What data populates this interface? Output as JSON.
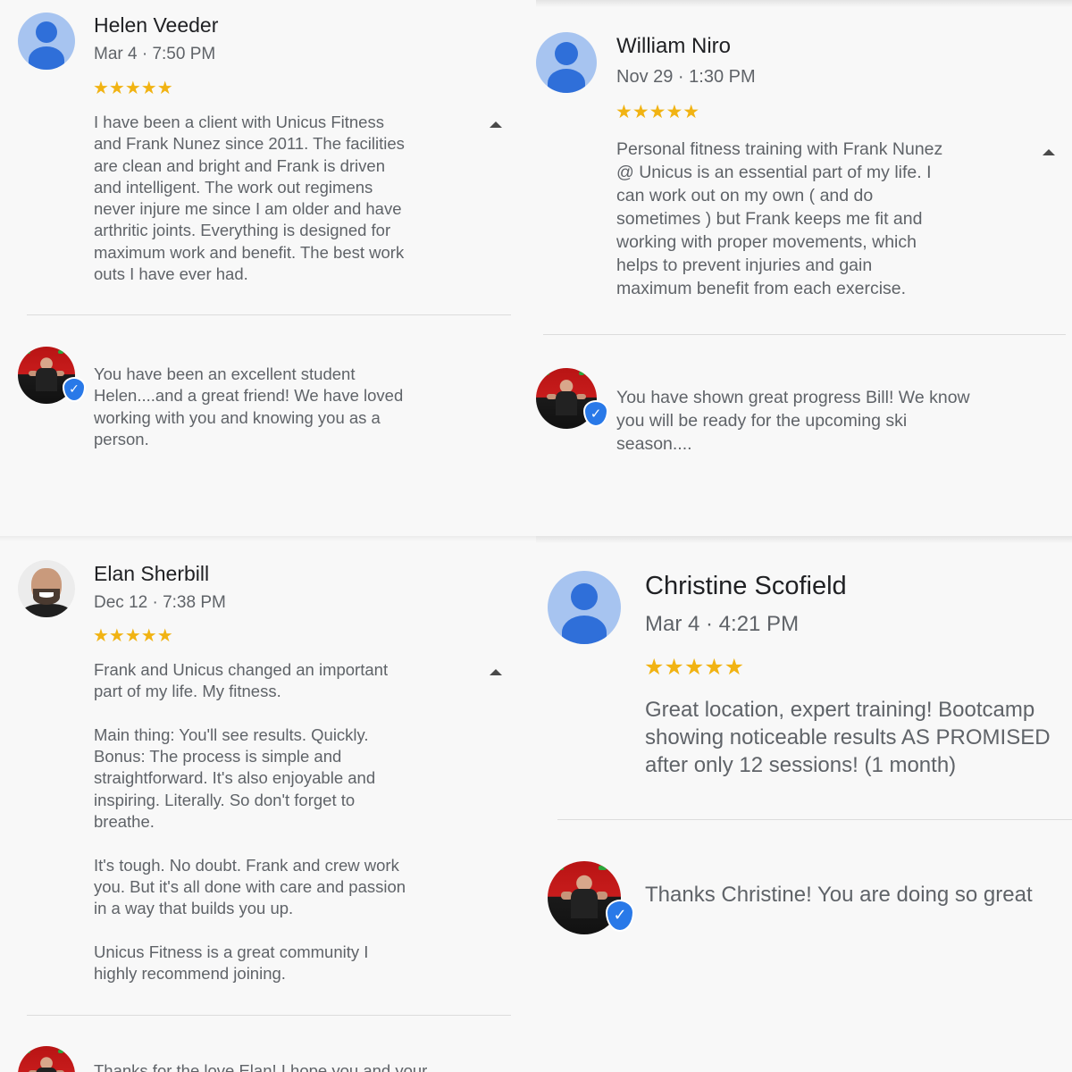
{
  "reviews": [
    {
      "name": "Helen Veeder",
      "date": "Mar 4 · 7:50 PM",
      "stars": "★★★★★",
      "text": "I have been a client with Unicus Fitness\nand Frank Nunez since 2011.  The facilities\nare clean and bright and Frank is driven\nand intelligent.   The work out regimens\nnever injure me since I am older and have\narthritic joints.   Everything is designed for\nmaximum work and benefit.  The best work\nouts I have ever had.",
      "reply": "You have been an excellent student\nHelen....and a great friend! We have loved\nworking with you and knowing you as a\nperson."
    },
    {
      "name": "William Niro",
      "date": "Nov 29 · 1:30 PM",
      "stars": "★★★★★",
      "text": "Personal fitness training with Frank Nunez\n@ Unicus is an essential part of my life. I\ncan work out on my own ( and do\nsometimes ) but Frank keeps me fit and\nworking with proper movements, which\nhelps to prevent injuries and gain\nmaximum benefit from each exercise.",
      "reply": "You have shown great progress Bill! We know\nyou will be ready for the upcoming ski\nseason...."
    },
    {
      "name": "Elan Sherbill",
      "date": "Dec 12 · 7:38 PM",
      "stars": "★★★★★",
      "text": "Frank and Unicus changed an important\npart of my life. My fitness.\n\nMain thing: You'll see results. Quickly.\nBonus: The process is simple and\nstraightforward.  It's also enjoyable and\ninspiring. Literally. So don't forget to\nbreathe.\n\nIt's tough. No doubt. Frank and crew work\nyou. But it's all done with care and passion\nin a way that builds you up.\n\nUnicus Fitness is a great community I\nhighly recommend joining.",
      "reply": "Thanks for the love Elan! I hope you and your"
    },
    {
      "name": "Christine Scofield",
      "date": "Mar 4 · 4:21 PM",
      "stars": "★★★★★",
      "text": "Great location, expert training! Bootcamp\nshowing noticeable results AS PROMISED\nafter only 12 sessions! (1 month)",
      "reply": "Thanks Christine! You are doing so great"
    }
  ],
  "icons": {
    "collapse": "caret-up-icon",
    "verified": "verified-badge-icon",
    "badge_glyph": "✓"
  },
  "colors": {
    "stars": "#f1b313",
    "avatar_bg": "#a7c4f0",
    "avatar_fg": "#2f6fd9",
    "verified": "#2979e8"
  }
}
